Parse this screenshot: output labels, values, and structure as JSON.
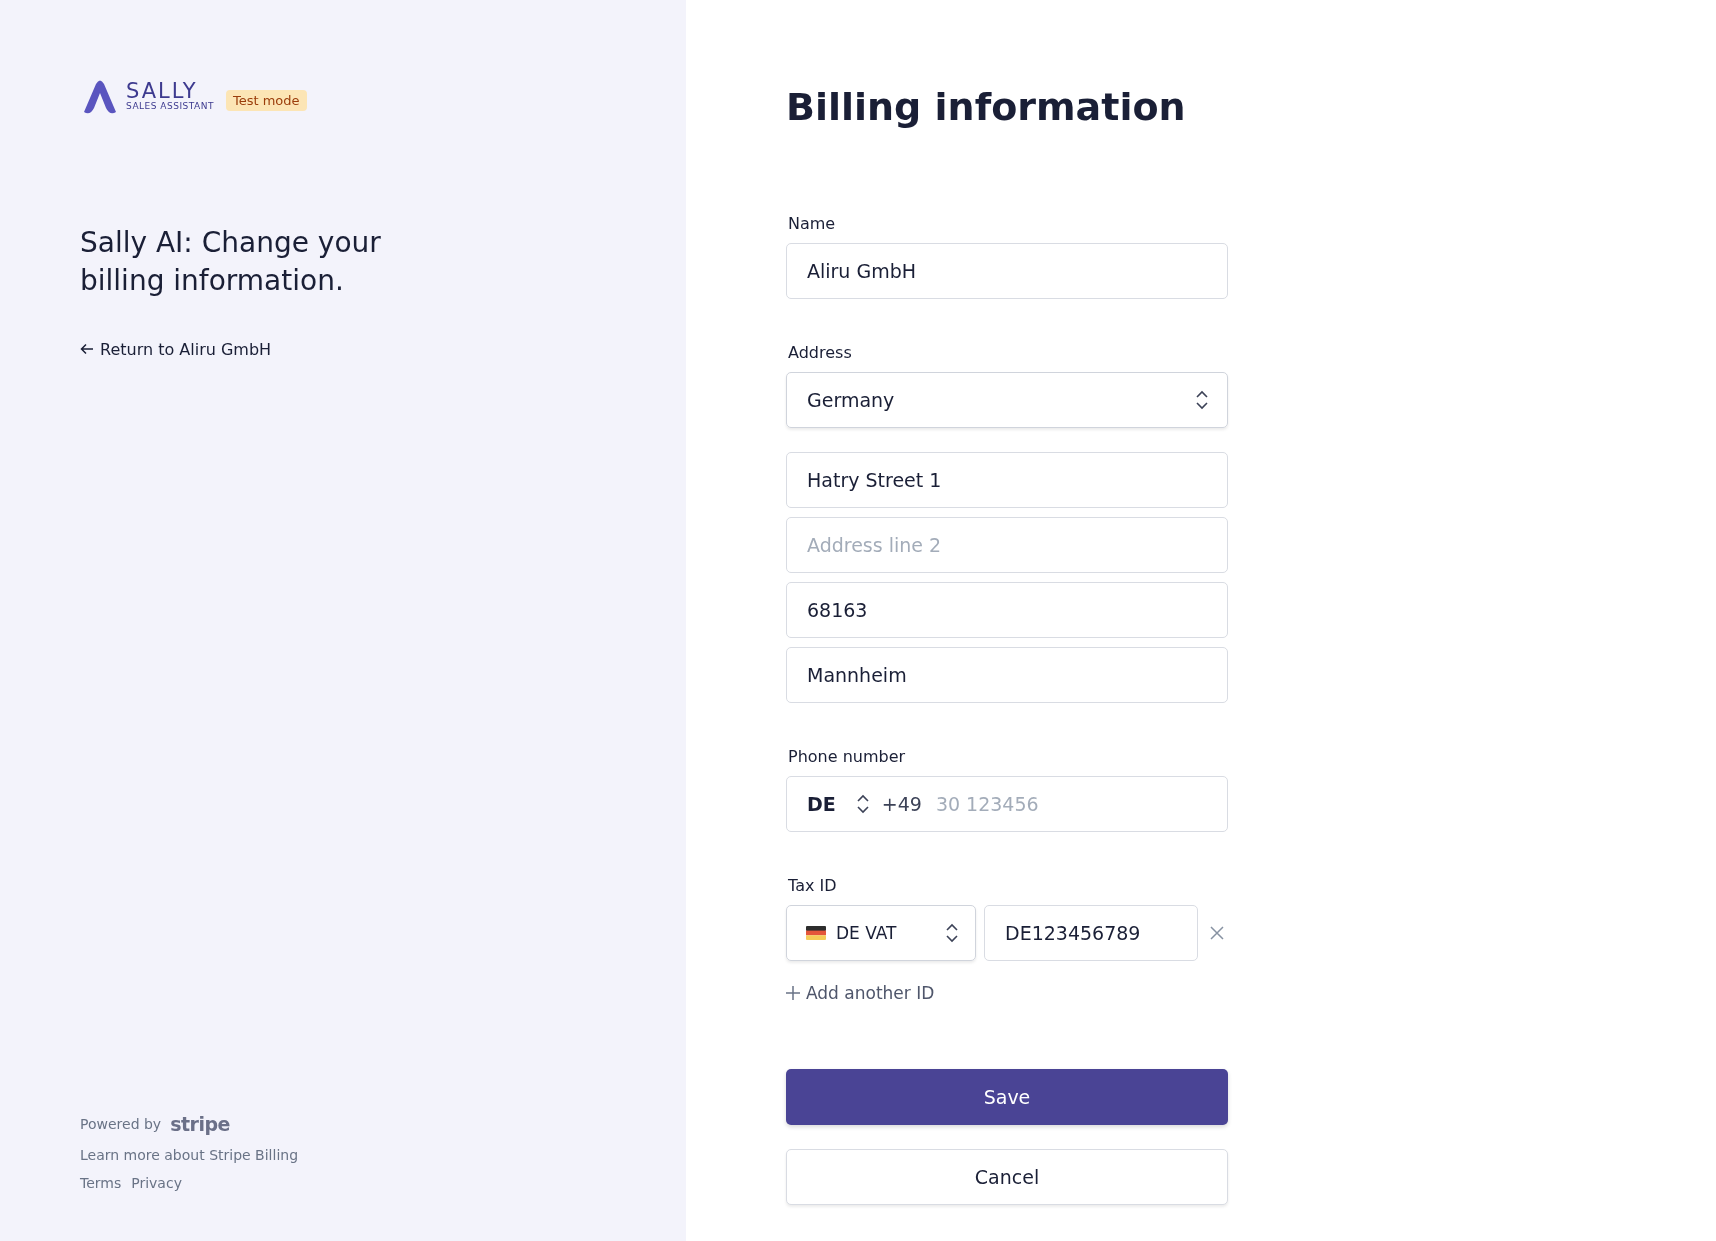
{
  "brand": {
    "name": "SALLY",
    "tagline": "SALES ASSISTANT",
    "badge": "Test mode"
  },
  "heading": "Sally AI: Change your billing information.",
  "back_link": "Return to Aliru GmbH",
  "footer": {
    "powered_by": "Powered by",
    "provider": "stripe",
    "learn_more": "Learn more about Stripe Billing",
    "links": [
      "Terms",
      "Privacy"
    ]
  },
  "title": "Billing information",
  "name": {
    "label": "Name",
    "value": "Aliru GmbH"
  },
  "address": {
    "label": "Address",
    "country": "Germany",
    "fields": [
      {
        "value": "Hatry Street 1"
      },
      {
        "placeholder": "Address line 2"
      },
      {
        "value": "68163"
      },
      {
        "value": "Mannheim"
      }
    ]
  },
  "phone": {
    "label": "Phone number",
    "country": "DE",
    "code": "+49",
    "placeholder": "30 123456"
  },
  "tax": {
    "label": "Tax ID",
    "type": "DE VAT",
    "value": "DE123456789",
    "add": "Add another ID"
  },
  "buttons": [
    {
      "label": "Save",
      "kind": "primary"
    },
    {
      "label": "Cancel",
      "kind": "secondary"
    }
  ]
}
